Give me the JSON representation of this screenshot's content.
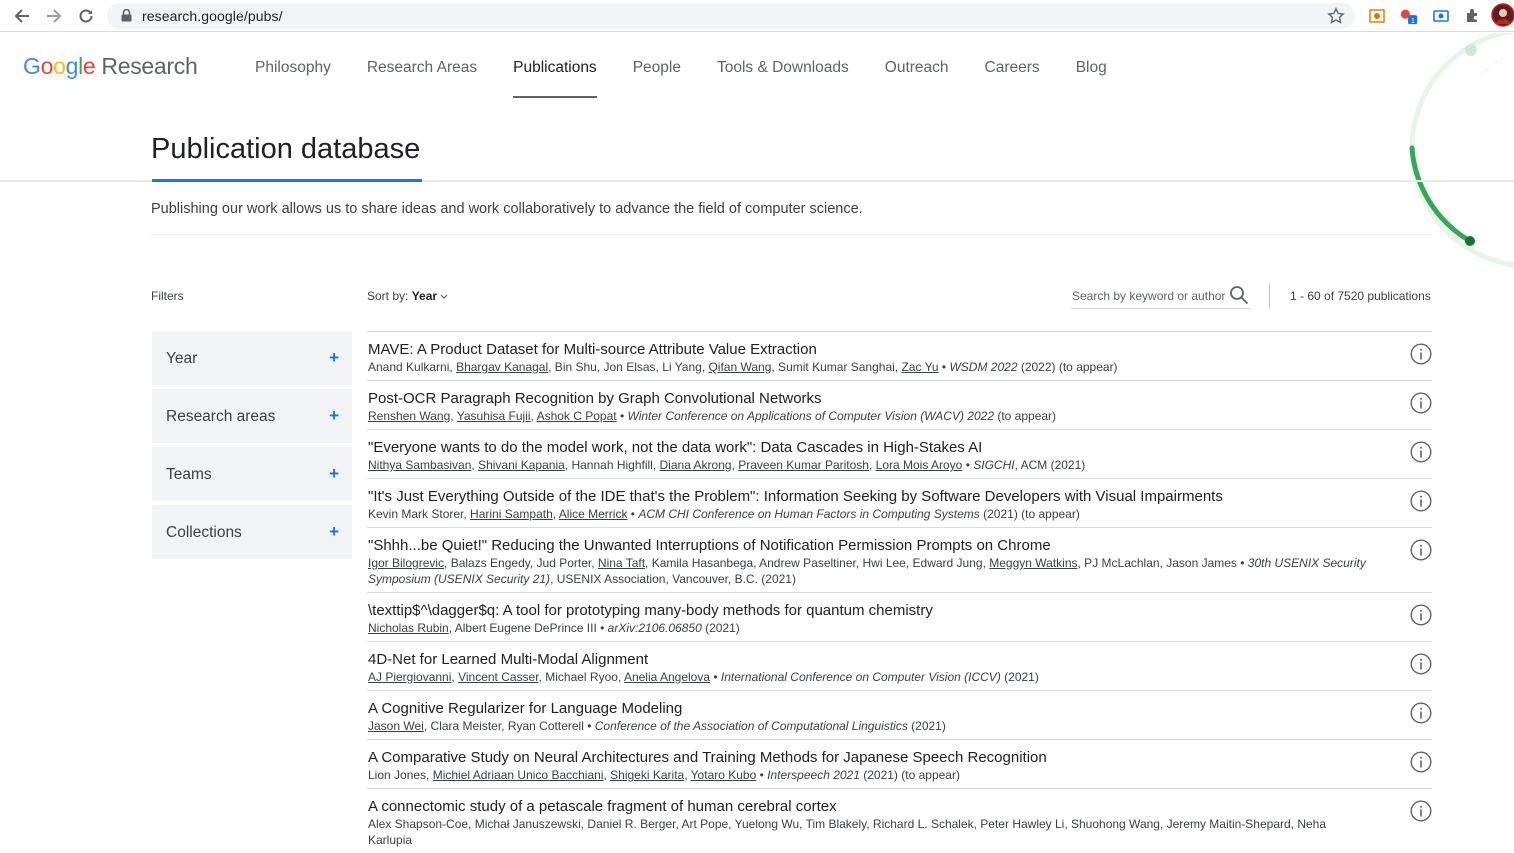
{
  "browser": {
    "url": "research.google/pubs/"
  },
  "site": {
    "logo_google": "Google",
    "logo_research": "Research",
    "nav": [
      "Philosophy",
      "Research Areas",
      "Publications",
      "People",
      "Tools & Downloads",
      "Outreach",
      "Careers",
      "Blog"
    ],
    "active_nav": "Publications"
  },
  "page": {
    "title": "Publication database",
    "intro": "Publishing our work allows us to share ideas and work collaboratively to advance the field of computer science."
  },
  "filters": {
    "label": "Filters",
    "items": [
      "Year",
      "Research areas",
      "Teams",
      "Collections"
    ]
  },
  "toolbar": {
    "sort_prefix": "Sort by:",
    "sort_value": "Year",
    "search_placeholder": "Search by keyword or author",
    "count": "1 - 60 of 7520 publications"
  },
  "publications": [
    {
      "title": "MAVE: A Product Dataset for Multi-source Attribute Value Extraction",
      "meta": [
        [
          "Anand Kulkarni",
          0
        ],
        [
          ", ",
          0
        ],
        [
          "Bhargav Kanagal",
          1
        ],
        [
          ", Bin Shu, Jon Elsas, Li Yang, ",
          0
        ],
        [
          "Qifan Wang",
          1
        ],
        [
          ", Sumit Kumar Sanghai, ",
          0
        ],
        [
          "Zac Yu",
          1
        ],
        [
          "  •  ",
          0
        ],
        [
          "WSDM 2022",
          2
        ],
        [
          " (2022) (to appear)",
          0
        ]
      ]
    },
    {
      "title": "Post-OCR Paragraph Recognition by Graph Convolutional Networks",
      "meta": [
        [
          "Renshen Wang",
          1
        ],
        [
          ", ",
          0
        ],
        [
          "Yasuhisa Fujii",
          1
        ],
        [
          ", ",
          0
        ],
        [
          "Ashok C Popat",
          1
        ],
        [
          "  •  ",
          0
        ],
        [
          "Winter Conference on Applications of Computer Vision (WACV) 2022",
          2
        ],
        [
          " (to appear)",
          0
        ]
      ]
    },
    {
      "title": "\"Everyone wants to do the model work, not the data work\": Data Cascades in High-Stakes AI",
      "meta": [
        [
          "Nithya Sambasivan",
          1
        ],
        [
          ", ",
          0
        ],
        [
          "Shivani Kapania",
          1
        ],
        [
          ", Hannah Highfill, ",
          0
        ],
        [
          "Diana Akrong",
          1
        ],
        [
          ", ",
          0
        ],
        [
          "Praveen Kumar Paritosh",
          1
        ],
        [
          ", ",
          0
        ],
        [
          "Lora Mois Aroyo",
          1
        ],
        [
          "  •  ",
          0
        ],
        [
          "SIGCHI",
          2
        ],
        [
          ", ACM (2021)",
          0
        ]
      ]
    },
    {
      "title": "\"It's Just Everything Outside of the IDE that's the Problem\": Information Seeking by Software Developers with Visual Impairments",
      "meta": [
        [
          "Kevin Mark Storer, ",
          0
        ],
        [
          "Harini Sampath",
          1
        ],
        [
          ", ",
          0
        ],
        [
          "Alice Merrick",
          1
        ],
        [
          "  •  ",
          0
        ],
        [
          "ACM CHI Conference on Human Factors in Computing Systems",
          2
        ],
        [
          " (2021) (to appear)",
          0
        ]
      ]
    },
    {
      "title": "\"Shhh...be Quiet!\" Reducing the Unwanted Interruptions of Notification Permission Prompts on Chrome",
      "meta": [
        [
          "Igor Bilogrevic",
          1
        ],
        [
          ", Balazs Engedy, Jud Porter, ",
          0
        ],
        [
          "Nina Taft",
          1
        ],
        [
          ", Kamila Hasanbega, Andrew Paseltiner, Hwi Lee, Edward Jung, ",
          0
        ],
        [
          "Meggyn Watkins",
          1
        ],
        [
          ", PJ McLachlan, Jason James  •  ",
          0
        ],
        [
          "30th USENIX Security Symposium (USENIX Security 21)",
          2
        ],
        [
          ", USENIX Association, Vancouver, B.C. (2021)",
          0
        ]
      ]
    },
    {
      "title": "\\texttip$^\\dagger$q: A tool for prototyping many-body methods for quantum chemistry",
      "meta": [
        [
          "Nicholas Rubin",
          1
        ],
        [
          ", Albert Eugene DePrince III  •  ",
          0
        ],
        [
          "arXiv:2106.06850",
          2
        ],
        [
          " (2021)",
          0
        ]
      ]
    },
    {
      "title": "4D-Net for Learned Multi-Modal Alignment",
      "meta": [
        [
          "AJ Piergiovanni",
          1
        ],
        [
          ", ",
          0
        ],
        [
          "Vincent Casser",
          1
        ],
        [
          ", Michael Ryoo, ",
          0
        ],
        [
          "Anelia Angelova",
          1
        ],
        [
          "  •  ",
          0
        ],
        [
          "International Conference on Computer Vision (ICCV)",
          2
        ],
        [
          " (2021)",
          0
        ]
      ]
    },
    {
      "title": "A Cognitive Regularizer for Language Modeling",
      "meta": [
        [
          "Jason Wei",
          1
        ],
        [
          ", Clara Meister, Ryan Cotterell  •  ",
          0
        ],
        [
          "Conference of the Association of Computational Linguistics",
          2
        ],
        [
          " (2021)",
          0
        ]
      ]
    },
    {
      "title": "A Comparative Study on Neural Architectures and Training Methods for Japanese Speech Recognition",
      "meta": [
        [
          "Lion Jones, ",
          0
        ],
        [
          "Michiel Adriaan Unico Bacchiani",
          1
        ],
        [
          ", ",
          0
        ],
        [
          "Shigeki Karita",
          1
        ],
        [
          ", ",
          0
        ],
        [
          "Yotaro Kubo",
          1
        ],
        [
          "  •  ",
          0
        ],
        [
          "Interspeech 2021",
          2
        ],
        [
          " (2021) (to appear)",
          0
        ]
      ]
    },
    {
      "title": "A connectomic study of a petascale fragment of human cerebral cortex",
      "meta": [
        [
          "Alex Shapson-Coe, Michał Januszewski, Daniel R. Berger, Art Pope, Yuelong Wu, Tim Blakely, Richard L. Schalek, Peter Hawley Li, Shuohong Wang, Jeremy Maitin-Shepard, Neha Karlupia",
          0
        ]
      ]
    }
  ]
}
